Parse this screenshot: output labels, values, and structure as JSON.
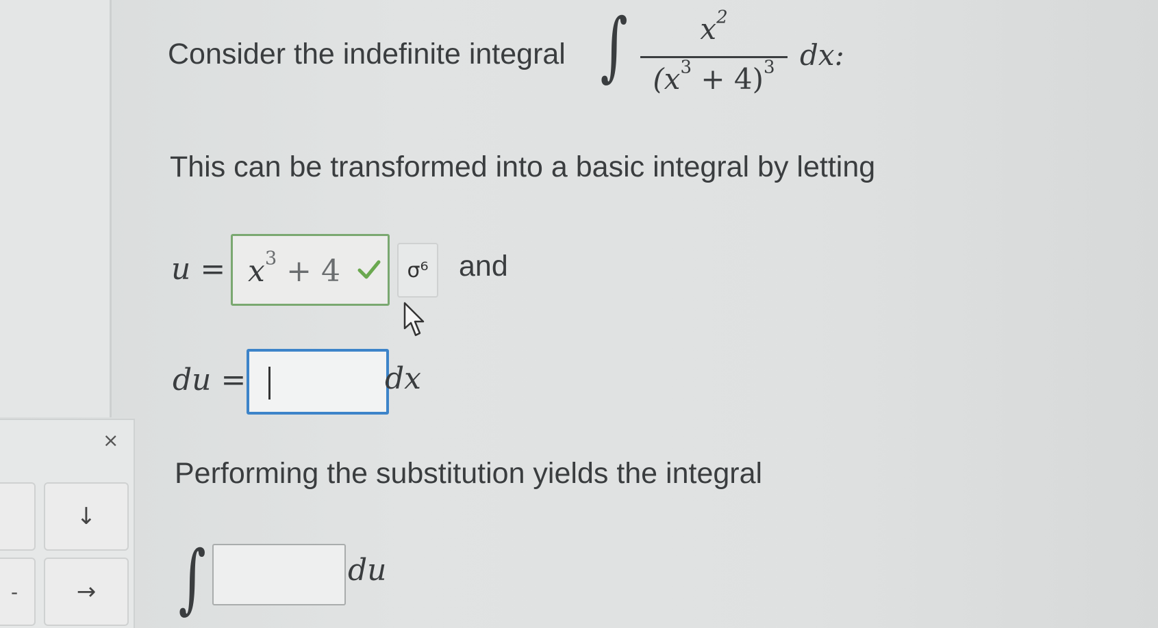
{
  "question": {
    "intro": "Consider the indefinite integral",
    "integrand_numerator": "x",
    "integrand_numerator_exp": "2",
    "integrand_denominator_base": "(x",
    "integrand_denominator_inner_exp": "3",
    "integrand_denominator_rest": " + 4)",
    "integrand_denominator_exp": "3",
    "differential": "dx:",
    "transform_text": "This can be transformed into a basic integral by letting",
    "u_label": "u =",
    "u_value_base": "x",
    "u_value_exp": "3",
    "u_value_rest": " + 4",
    "and_text": "and",
    "du_label": "du =",
    "du_value": "",
    "dx_text": "dx",
    "substitution_text": "Performing the substitution yields the integral",
    "integral_value": "",
    "du_suffix": "du"
  },
  "keypad": {
    "close_label": "×",
    "key_down": "↓",
    "key_right": "→",
    "key_left_top": "",
    "key_left_bottom": "-"
  },
  "key_icon": "σ⁶",
  "colors": {
    "correct_border": "#7aa870",
    "correct_check": "#6aa84f",
    "active_border": "#3d84c9"
  }
}
